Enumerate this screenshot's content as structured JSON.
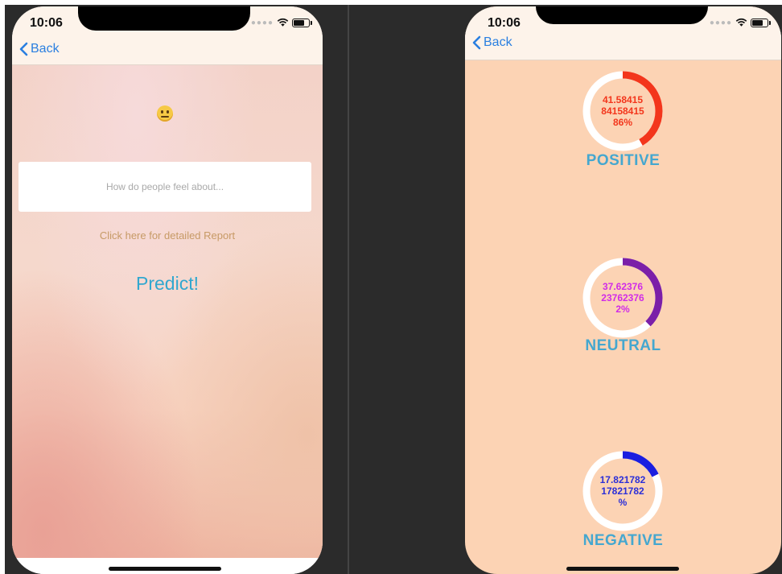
{
  "left_phone": {
    "status": {
      "time": "10:06"
    },
    "nav": {
      "back_label": "Back"
    },
    "search": {
      "placeholder": "How do people feel about..."
    },
    "report_link": "Click here for detailed Report",
    "predict_label": "Predict!",
    "emoji": "neutral-face-icon"
  },
  "right_phone": {
    "status": {
      "time": "10:06"
    },
    "nav": {
      "back_label": "Back"
    },
    "gauges": [
      {
        "label": "POSITIVE",
        "lines": [
          "41.58415",
          "84158415",
          "86%"
        ],
        "value": 41.58,
        "color": "#f3361c"
      },
      {
        "label": "NEUTRAL",
        "lines": [
          "37.62376",
          "23762376",
          "2%"
        ],
        "value": 37.62,
        "color": "#7b1fa8"
      },
      {
        "label": "NEGATIVE",
        "lines": [
          "17.821782",
          "17821782",
          "%"
        ],
        "value": 17.82,
        "color": "#1a1ee0"
      }
    ]
  },
  "colors": {
    "text_positive": "#f3361c",
    "text_neutral": "#d02ce8",
    "text_negative": "#2b2fd8",
    "accent_blue": "#2a7fe0",
    "label_blue": "#45a7cf"
  }
}
